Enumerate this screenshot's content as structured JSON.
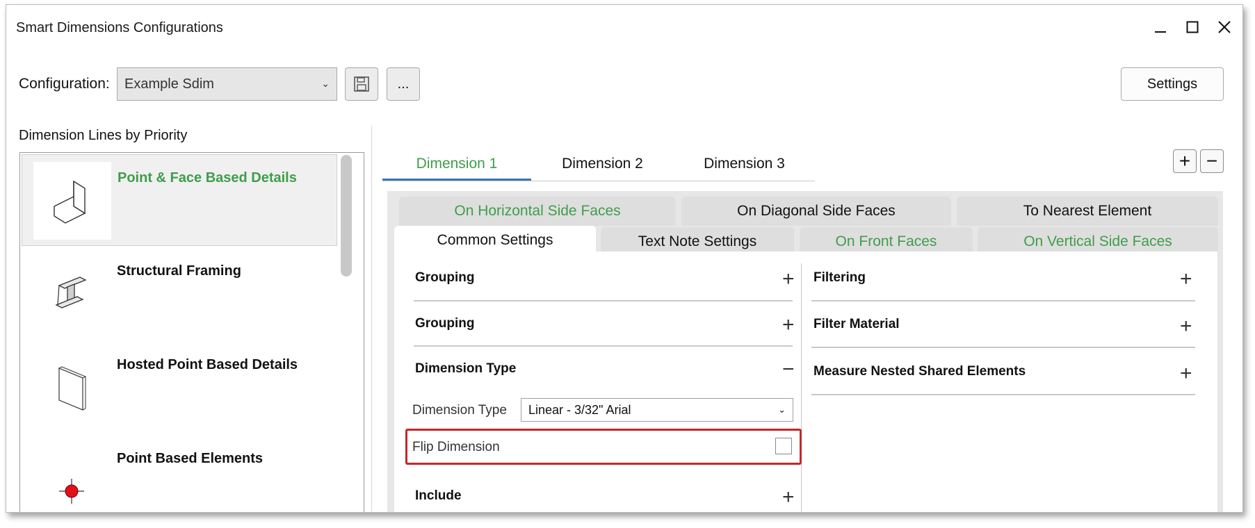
{
  "window": {
    "title": "Smart Dimensions Configurations",
    "controls": {
      "minimize": "—",
      "maximize": "☐",
      "close": "✕"
    }
  },
  "toolbar": {
    "configuration_label": "Configuration:",
    "configuration_value": "Example Sdim",
    "more_label": "...",
    "settings_label": "Settings"
  },
  "left_panel": {
    "title": "Dimension Lines by Priority",
    "items": [
      {
        "label": "Point & Face Based Details",
        "icon": "l-bracket-icon",
        "selected": true
      },
      {
        "label": "Structural Framing",
        "icon": "i-beam-icon",
        "selected": false
      },
      {
        "label": "Hosted Point Based Details",
        "icon": "panel-icon",
        "selected": false
      },
      {
        "label": "Point Based Elements",
        "icon": "red-point-icon",
        "selected": false
      }
    ]
  },
  "dimension_tabs": {
    "tabs": [
      "Dimension 1",
      "Dimension 2",
      "Dimension 3"
    ],
    "active_index": 0,
    "add_label": "+",
    "remove_label": "−"
  },
  "sub_tabs": {
    "row1": [
      "On Horizontal Side Faces",
      "On Diagonal Side Faces",
      "To Nearest Element"
    ],
    "row2": [
      "Common Settings",
      "Text Note Settings",
      "On Front Faces",
      "On Vertical Side Faces"
    ],
    "active": "Common Settings"
  },
  "left_sections": [
    {
      "title": "Grouping",
      "toggle": "+"
    },
    {
      "title": "Grouping",
      "toggle": "+"
    },
    {
      "title": "Dimension Type",
      "toggle": "−"
    },
    {
      "title": "Include",
      "toggle": "+"
    }
  ],
  "dimension_type": {
    "label": "Dimension Type",
    "value": "Linear - 3/32\" Arial",
    "flip_label": "Flip Dimension",
    "flip_checked": false
  },
  "right_sections": [
    {
      "title": "Filtering",
      "toggle": "+"
    },
    {
      "title": "Filter Material",
      "toggle": "+"
    },
    {
      "title": "Measure Nested Shared Elements",
      "toggle": "+"
    }
  ],
  "colors": {
    "accent_green": "#3f9d4a",
    "active_underline": "#3b75b7",
    "highlight_red": "#c0292b"
  }
}
